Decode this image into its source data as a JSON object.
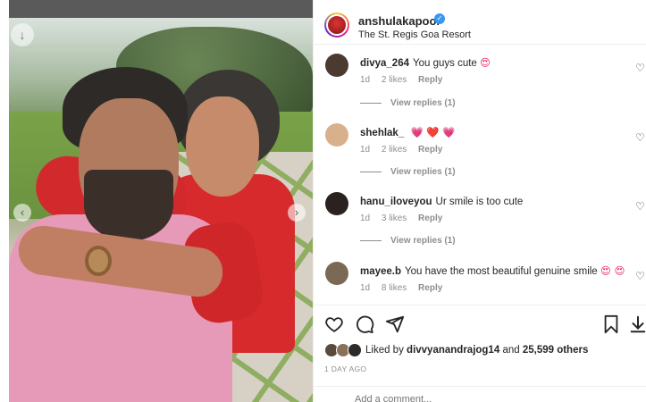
{
  "post": {
    "username": "anshulakapoor",
    "verified": true,
    "location": "The St. Regis Goa Resort"
  },
  "photo": {
    "description_icon": "photo",
    "prev_icon": "chevron-left-icon",
    "next_icon": "chevron-right-icon"
  },
  "comments": [
    {
      "user": "divya_264",
      "text": "You guys cute",
      "emoji": "😍",
      "age": "1d",
      "likes": "2 likes",
      "reply": "Reply",
      "view_replies": "View replies (1)",
      "avatar_color": "#4a3a30"
    },
    {
      "user": "shehlak_",
      "text": "",
      "emoji": "💗 ❤️ 💗",
      "age": "1d",
      "likes": "2 likes",
      "reply": "Reply",
      "view_replies": "View replies (1)",
      "avatar_color": "#d9b08c"
    },
    {
      "user": "hanu_iloveyou",
      "text": "Ur smile is too cute",
      "emoji": "",
      "age": "1d",
      "likes": "3 likes",
      "reply": "Reply",
      "view_replies": "View replies (1)",
      "avatar_color": "#2b2220"
    },
    {
      "user": "mayee.b",
      "text": "You have the most beautiful genuine smile",
      "emoji": "😍 😍",
      "age": "1d",
      "likes": "8 likes",
      "reply": "Reply",
      "view_replies": "",
      "avatar_color": "#7a6a55"
    }
  ],
  "actions": {
    "like_icon": "heart-icon",
    "comment_icon": "comment-icon",
    "share_icon": "share-icon",
    "save_icon": "bookmark-icon",
    "download_icon": "download-icon"
  },
  "likes": {
    "prefix": "Liked by",
    "user": "divvyanandrajog14",
    "and": "and",
    "others": "25,599 others"
  },
  "timestamp": "1 DAY AGO",
  "add_comment": {
    "placeholder": "Add a comment..."
  },
  "colors": {
    "verified": "#3897f0",
    "muted": "#8e8e8e",
    "text": "#262626"
  }
}
